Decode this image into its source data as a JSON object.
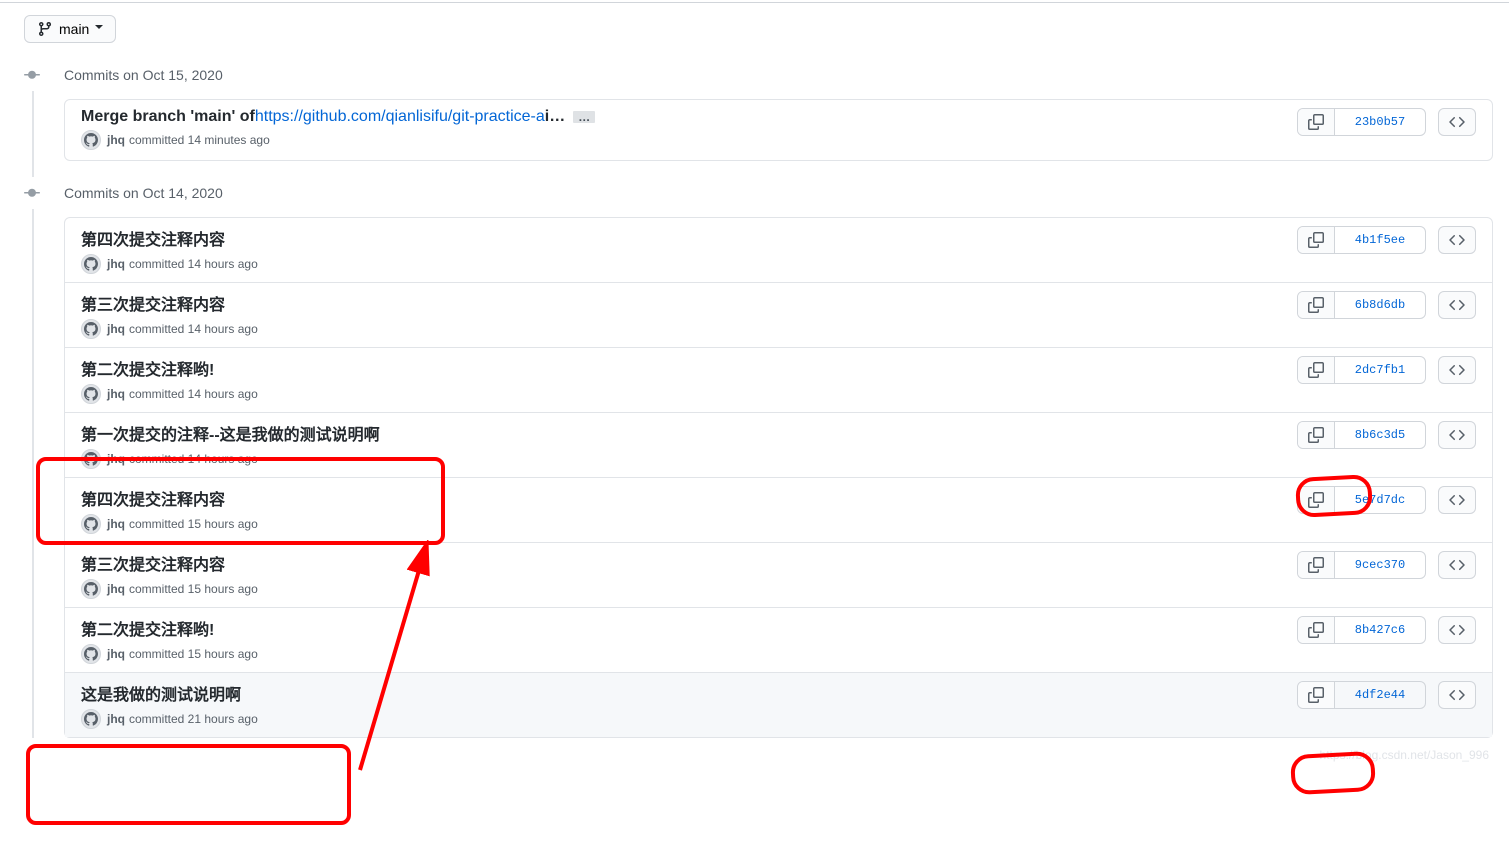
{
  "branch": {
    "name": "main"
  },
  "groups": [
    {
      "date": "Commits on Oct 15, 2020",
      "commits": [
        {
          "title_prefix": "Merge branch 'main' of ",
          "title_link": "https://github.com/qianlisifu/git-practice-a",
          "title_suffix": " i…",
          "has_ellipsis": true,
          "author": "jhq",
          "time_text": "committed 14 minutes ago",
          "sha": "23b0b57"
        }
      ]
    },
    {
      "date": "Commits on Oct 14, 2020",
      "commits": [
        {
          "title_prefix": "第四次提交注释内容",
          "author": "jhq",
          "time_text": "committed 14 hours ago",
          "sha": "4b1f5ee"
        },
        {
          "title_prefix": "第三次提交注释内容",
          "author": "jhq",
          "time_text": "committed 14 hours ago",
          "sha": "6b8d6db"
        },
        {
          "title_prefix": "第二次提交注释哟!",
          "author": "jhq",
          "time_text": "committed 14 hours ago",
          "sha": "2dc7fb1"
        },
        {
          "title_prefix": "第一次提交的注释--这是我做的测试说明啊",
          "author": "jhq",
          "time_text": "committed 14 hours ago",
          "sha": "8b6c3d5"
        },
        {
          "title_prefix": "第四次提交注释内容",
          "author": "jhq",
          "time_text": "committed 15 hours ago",
          "sha": "5e7d7dc"
        },
        {
          "title_prefix": "第三次提交注释内容",
          "author": "jhq",
          "time_text": "committed 15 hours ago",
          "sha": "9cec370"
        },
        {
          "title_prefix": "第二次提交注释哟!",
          "author": "jhq",
          "time_text": "committed 15 hours ago",
          "sha": "8b427c6"
        },
        {
          "title_prefix": "这是我做的测试说明啊",
          "author": "jhq",
          "time_text": "committed 21 hours ago",
          "sha": "4df2e44",
          "selected": true
        }
      ]
    }
  ],
  "watermark": "https://blog.csdn.net/Jason_996"
}
